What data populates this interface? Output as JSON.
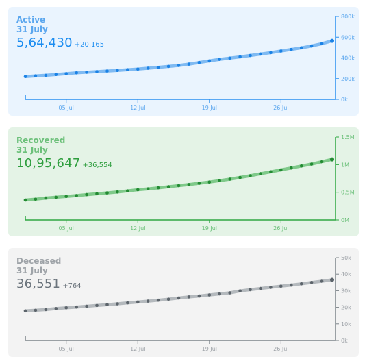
{
  "panels": [
    {
      "key": "active",
      "name": "Active",
      "date": "31 July",
      "value": "5,64,430",
      "delta": "+20,165",
      "colors": {
        "bg": "#eaf4fe",
        "main": "#1a8cf0",
        "dark": "#1a82e6",
        "line": "#7fbaf2",
        "text": "#5aa6ee",
        "axis": "#2a90f0"
      }
    },
    {
      "key": "recovered",
      "name": "Recovered",
      "date": "31 July",
      "value": "10,95,647",
      "delta": "+36,554",
      "colors": {
        "bg": "#e4f3e6",
        "main": "#2e9e3e",
        "dark": "#238a33",
        "line": "#7fc98a",
        "text": "#6cc07a",
        "axis": "#2ea842"
      }
    },
    {
      "key": "deceased",
      "name": "Deceased",
      "date": "31 July",
      "value": "36,551",
      "delta": "+764",
      "colors": {
        "bg": "#f3f3f3",
        "main": "#6c757d",
        "dark": "#5c646b",
        "line": "#b4b9bd",
        "text": "#9ea3a8",
        "axis": "#7d848a"
      }
    }
  ],
  "chart_data": [
    {
      "type": "line",
      "title": "Active",
      "x": [
        "01 Jul",
        "02 Jul",
        "03 Jul",
        "04 Jul",
        "05 Jul",
        "06 Jul",
        "07 Jul",
        "08 Jul",
        "09 Jul",
        "10 Jul",
        "11 Jul",
        "12 Jul",
        "13 Jul",
        "14 Jul",
        "15 Jul",
        "16 Jul",
        "17 Jul",
        "18 Jul",
        "19 Jul",
        "20 Jul",
        "21 Jul",
        "22 Jul",
        "23 Jul",
        "24 Jul",
        "25 Jul",
        "26 Jul",
        "27 Jul",
        "28 Jul",
        "29 Jul",
        "30 Jul",
        "31 Jul"
      ],
      "x_ticks": [
        "05 Jul",
        "12 Jul",
        "19 Jul",
        "26 Jul"
      ],
      "y_ticks": [
        "0k",
        "200k",
        "400k",
        "600k",
        "800k"
      ],
      "ylim": [
        0,
        800000
      ],
      "values": [
        220000,
        227000,
        232000,
        240000,
        248000,
        256000,
        262000,
        268000,
        274000,
        280000,
        286000,
        292000,
        301000,
        309000,
        318000,
        327000,
        340000,
        356000,
        371000,
        386000,
        398000,
        410000,
        423000,
        437000,
        450000,
        466000,
        481000,
        497000,
        515000,
        537000,
        564430
      ]
    },
    {
      "type": "line",
      "title": "Recovered",
      "x": [
        "01 Jul",
        "02 Jul",
        "03 Jul",
        "04 Jul",
        "05 Jul",
        "06 Jul",
        "07 Jul",
        "08 Jul",
        "09 Jul",
        "10 Jul",
        "11 Jul",
        "12 Jul",
        "13 Jul",
        "14 Jul",
        "15 Jul",
        "16 Jul",
        "17 Jul",
        "18 Jul",
        "19 Jul",
        "20 Jul",
        "21 Jul",
        "22 Jul",
        "23 Jul",
        "24 Jul",
        "25 Jul",
        "26 Jul",
        "27 Jul",
        "28 Jul",
        "29 Jul",
        "30 Jul",
        "31 Jul"
      ],
      "x_ticks": [
        "05 Jul",
        "12 Jul",
        "19 Jul",
        "26 Jul"
      ],
      "y_ticks": [
        "0M",
        "0.5M",
        "1M",
        "1.5M"
      ],
      "ylim": [
        0,
        1500000
      ],
      "values": [
        360000,
        375000,
        395000,
        410000,
        425000,
        440000,
        457000,
        472000,
        488000,
        505000,
        525000,
        545000,
        562000,
        580000,
        600000,
        620000,
        640000,
        663000,
        686000,
        710000,
        738000,
        768000,
        800000,
        835000,
        870000,
        905000,
        940000,
        975000,
        1010000,
        1052000,
        1095647
      ]
    },
    {
      "type": "line",
      "title": "Deceased",
      "x": [
        "01 Jul",
        "02 Jul",
        "03 Jul",
        "04 Jul",
        "05 Jul",
        "06 Jul",
        "07 Jul",
        "08 Jul",
        "09 Jul",
        "10 Jul",
        "11 Jul",
        "12 Jul",
        "13 Jul",
        "14 Jul",
        "15 Jul",
        "16 Jul",
        "17 Jul",
        "18 Jul",
        "19 Jul",
        "20 Jul",
        "21 Jul",
        "22 Jul",
        "23 Jul",
        "24 Jul",
        "25 Jul",
        "26 Jul",
        "27 Jul",
        "28 Jul",
        "29 Jul",
        "30 Jul",
        "31 Jul"
      ],
      "x_ticks": [
        "05 Jul",
        "12 Jul",
        "19 Jul",
        "26 Jul"
      ],
      "y_ticks": [
        "0k",
        "10k",
        "20k",
        "30k",
        "40k",
        "50k"
      ],
      "ylim": [
        0,
        50000
      ],
      "values": [
        17834,
        18213,
        18655,
        19268,
        19693,
        20160,
        20642,
        21129,
        21604,
        22123,
        22674,
        23174,
        23727,
        24309,
        24914,
        25602,
        26273,
        26816,
        27497,
        28084,
        28732,
        29861,
        30601,
        31358,
        32063,
        32771,
        33425,
        34193,
        35003,
        35747,
        36551
      ]
    }
  ]
}
